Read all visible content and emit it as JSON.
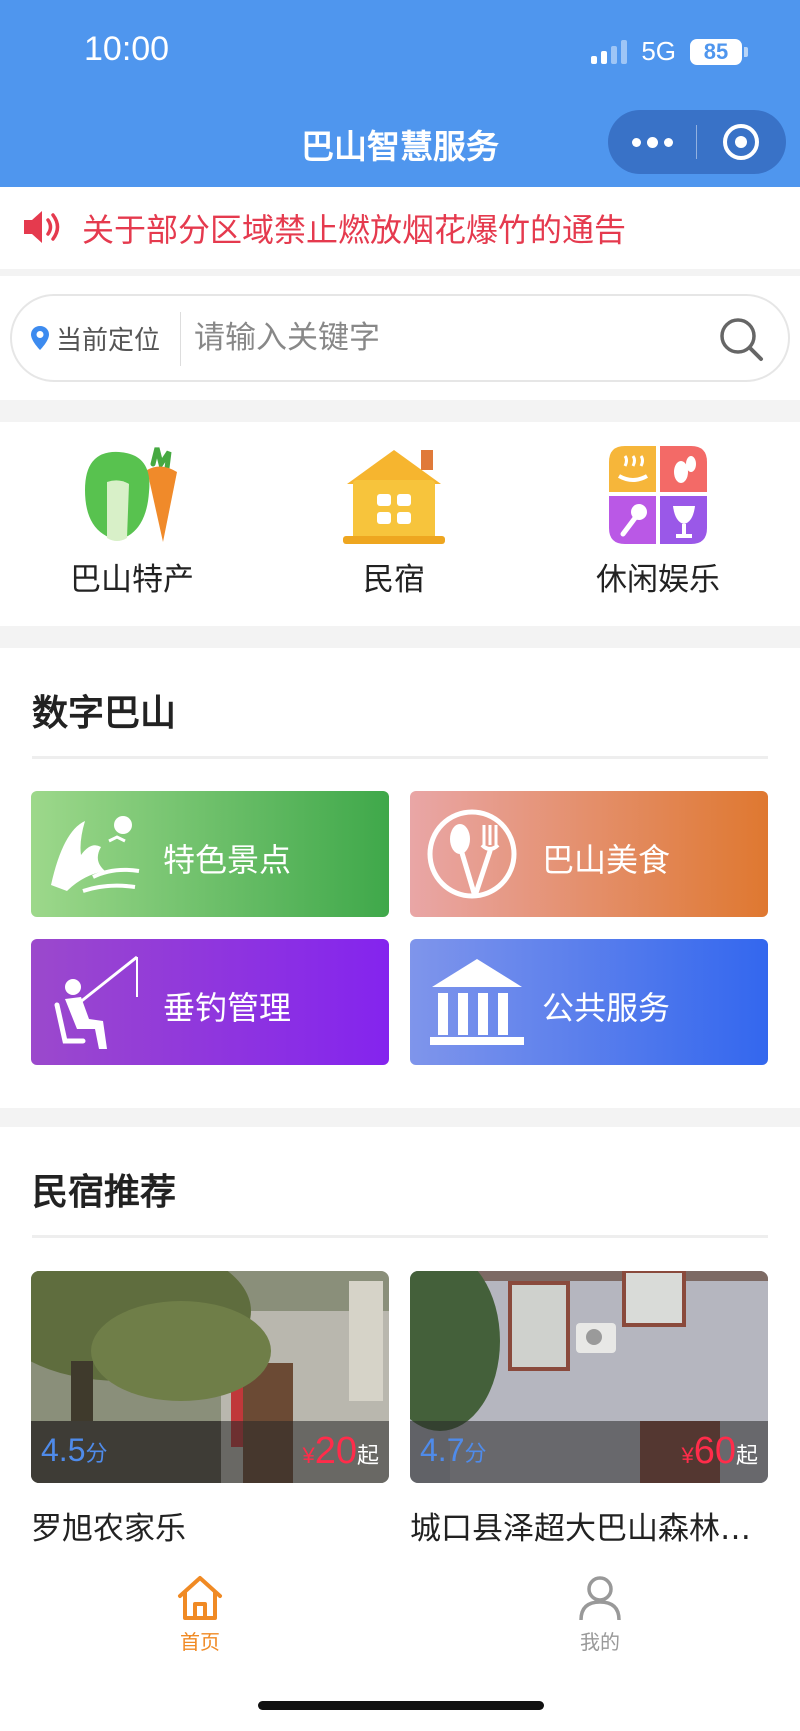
{
  "status_bar": {
    "time": "10:00",
    "network": "5G",
    "battery": "85"
  },
  "header": {
    "title": "巴山智慧服务"
  },
  "notice": {
    "text": "关于部分区域禁止燃放烟花爆竹的通告"
  },
  "search": {
    "location_label": "当前定位",
    "placeholder": "请输入关键字"
  },
  "categories": [
    {
      "label": "巴山特产",
      "icon": "vegetables-icon"
    },
    {
      "label": "民宿",
      "icon": "house-icon"
    },
    {
      "label": "休闲娱乐",
      "icon": "leisure-grid-icon"
    }
  ],
  "digital": {
    "title": "数字巴山",
    "tiles": [
      {
        "label": "特色景点",
        "icon": "mountain-scenery-icon",
        "color": "#3fa84a"
      },
      {
        "label": "巴山美食",
        "icon": "spoon-fork-icon",
        "color": "#df7830"
      },
      {
        "label": "垂钓管理",
        "icon": "fishing-icon",
        "color": "#8424ee"
      },
      {
        "label": "公共服务",
        "icon": "government-building-icon",
        "color": "#3367ee"
      }
    ]
  },
  "homestay": {
    "title": "民宿推荐",
    "items": [
      {
        "name": "罗旭农家乐",
        "score": "4.5",
        "score_unit": "分",
        "currency": "¥",
        "price": "20",
        "price_suffix": "起"
      },
      {
        "name": "城口县泽超大巴山森林人家",
        "score": "4.7",
        "score_unit": "分",
        "currency": "¥",
        "price": "60",
        "price_suffix": "起"
      }
    ]
  },
  "tabbar": {
    "items": [
      {
        "label": "首页",
        "active": true,
        "color": "#f08a24"
      },
      {
        "label": "我的",
        "active": false,
        "color": "#999999"
      }
    ]
  },
  "colors": {
    "header": "#4f96ee",
    "notice": "#e53a4e",
    "rating": "#4f8bea",
    "price": "#ff2c4a"
  }
}
